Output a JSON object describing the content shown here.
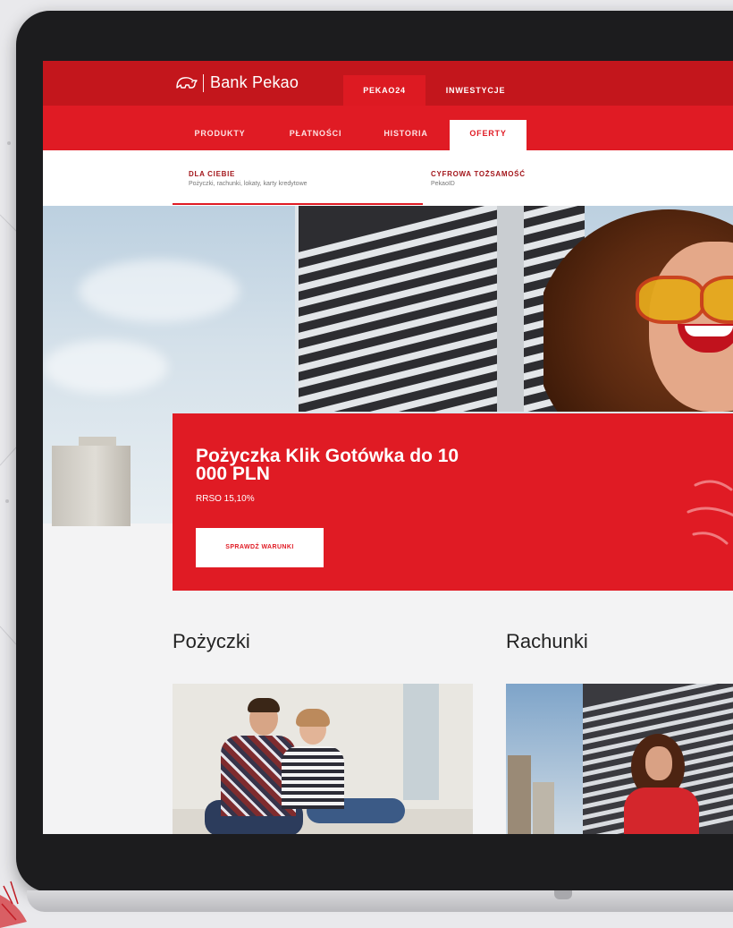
{
  "brand": {
    "name": "Bank Pekao",
    "accent": "#e01b24",
    "dark_red": "#c3161c"
  },
  "top_tabs": [
    {
      "label": "PEKAO24",
      "active": true
    },
    {
      "label": "INWESTYCJE",
      "active": false
    }
  ],
  "sub_tabs": [
    {
      "label": "PRODUKTY",
      "active": false
    },
    {
      "label": "PŁATNOŚCI",
      "active": false
    },
    {
      "label": "HISTORIA",
      "active": false
    },
    {
      "label": "OFERTY",
      "active": true
    }
  ],
  "offers": [
    {
      "title": "DLA CIEBIE",
      "subtitle": "Pożyczki, rachunki, lokaty, karty kredytowe"
    },
    {
      "title": "CYFROWA TOŻSAMOŚĆ",
      "subtitle": "PekaoID"
    }
  ],
  "promo": {
    "title": "Pożyczka Klik Gotówka do 10 000 PLN",
    "rrso": "RRSO 15,10%",
    "button": "SPRAWDŹ WARUNKI"
  },
  "sections": [
    {
      "title": "Pożyczki"
    },
    {
      "title": "Rachunki"
    }
  ],
  "icons": [
    "bank-logo-icon"
  ]
}
